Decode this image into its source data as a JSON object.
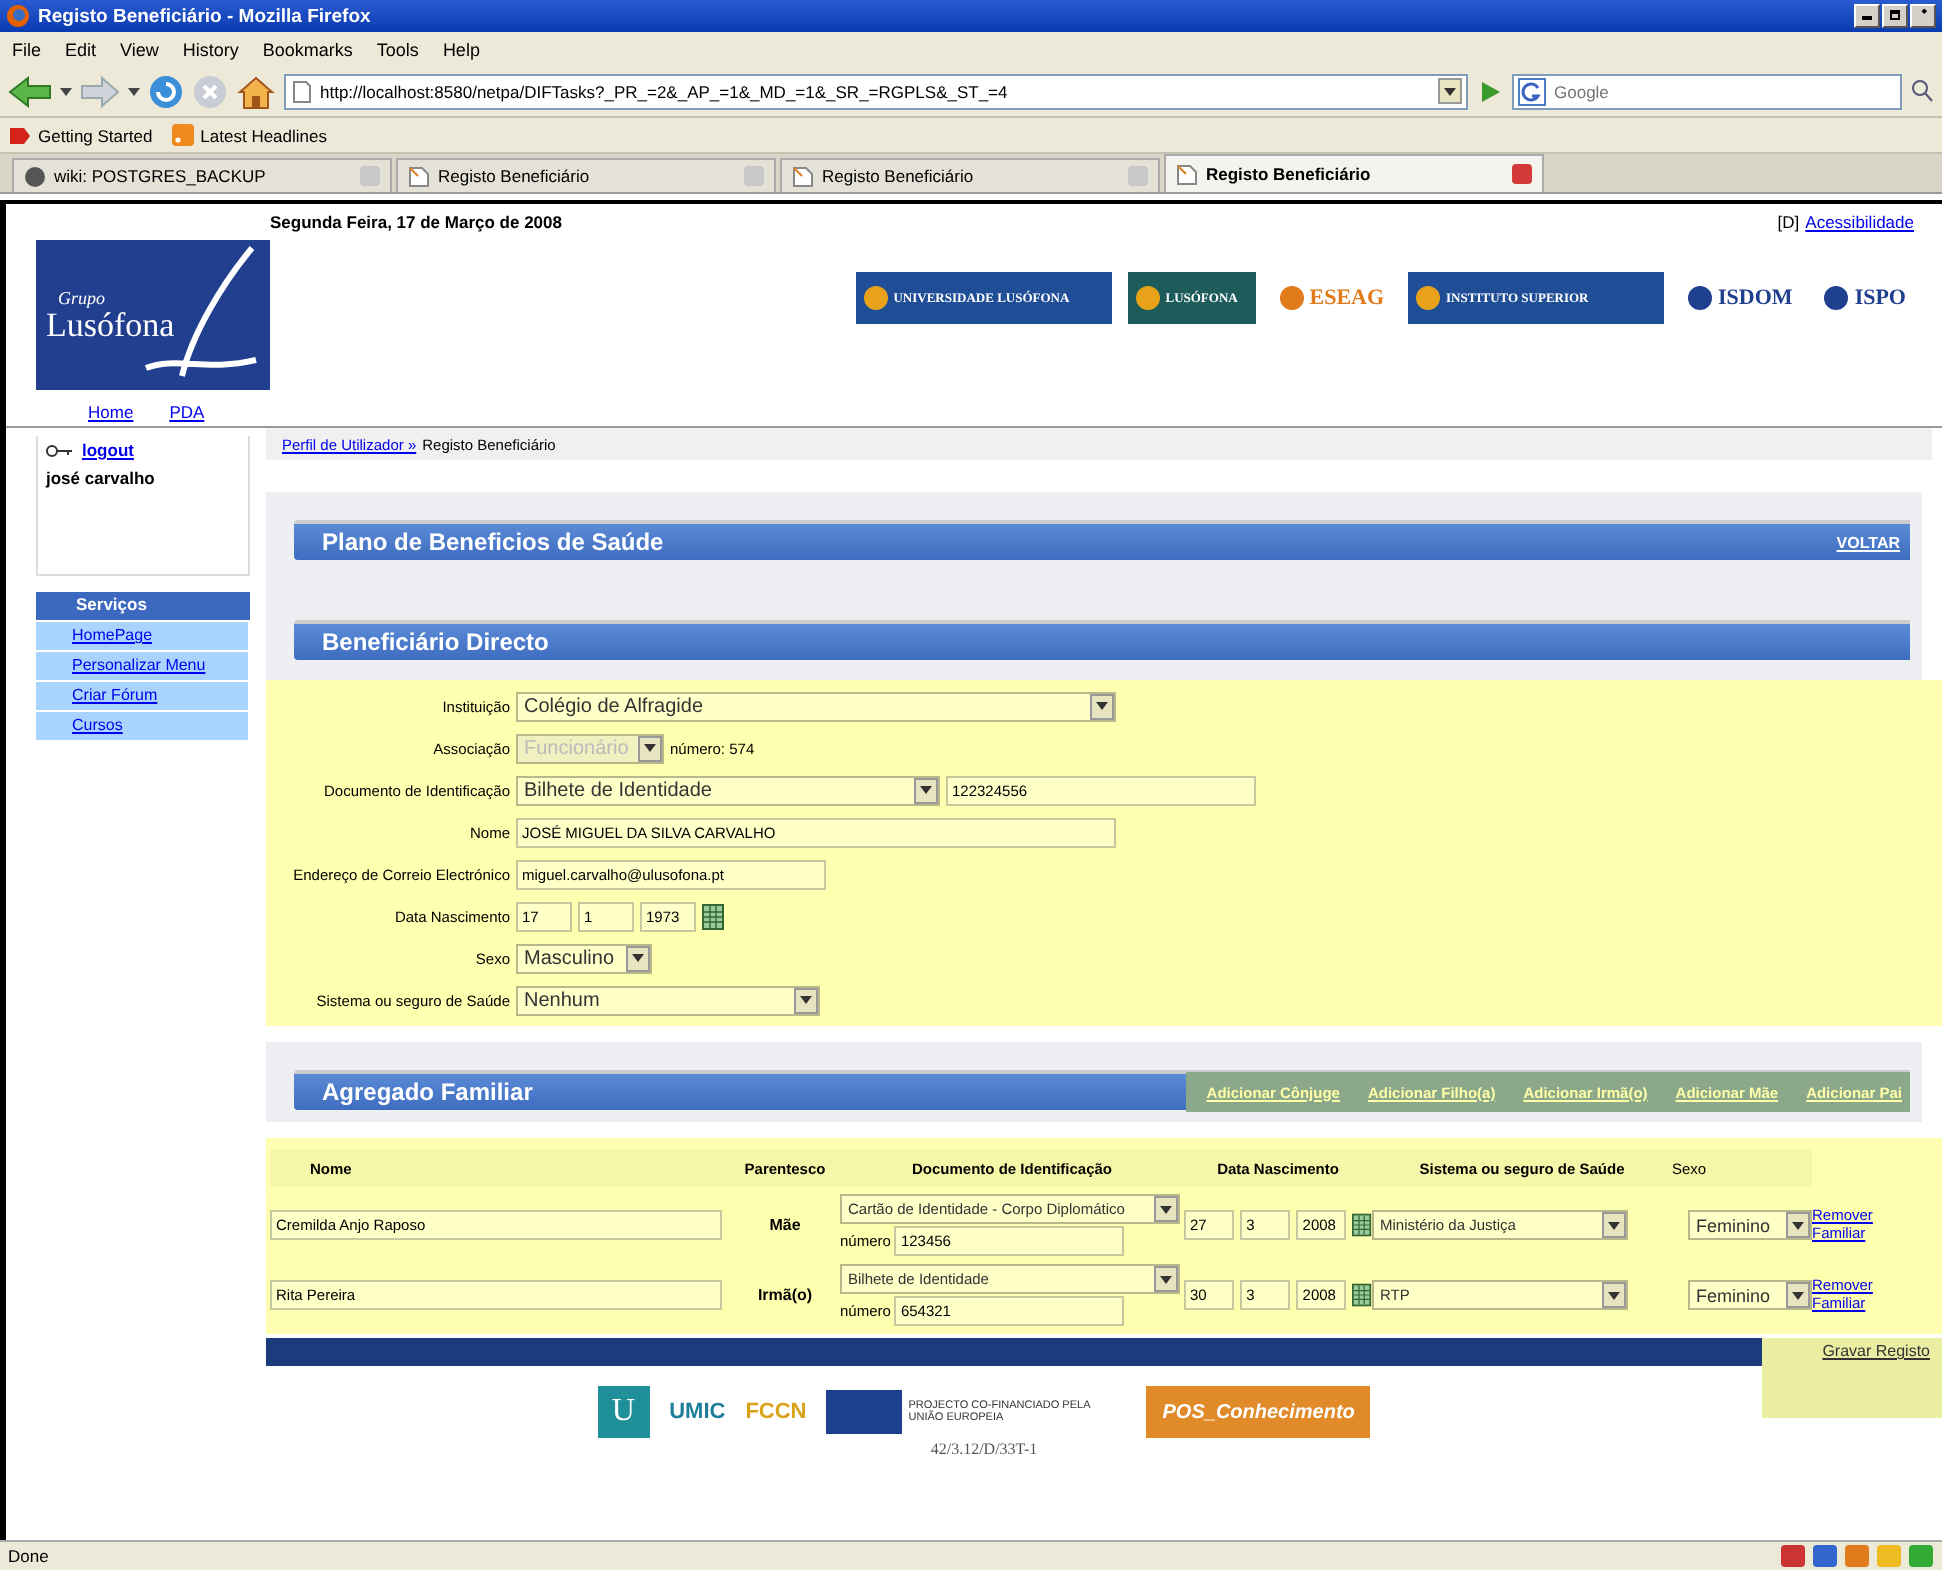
{
  "browser": {
    "title": "Registo Beneficiário - Mozilla Firefox",
    "menu": [
      "File",
      "Edit",
      "View",
      "History",
      "Bookmarks",
      "Tools",
      "Help"
    ],
    "url": "http://localhost:8580/netpa/DIFTasks?_PR_=2&_AP_=1&_MD_=1&_SR_=RGPLS&_ST_=4",
    "search_placeholder": "Google",
    "bookmarks": [
      "Getting Started",
      "Latest Headlines"
    ],
    "tabs": [
      {
        "label": "wiki: POSTGRES_BACKUP",
        "selected": false
      },
      {
        "label": "Registo Beneficiário",
        "selected": false
      },
      {
        "label": "Registo Beneficiário",
        "selected": false
      },
      {
        "label": "Registo Beneficiário",
        "selected": true
      }
    ],
    "status": "Done"
  },
  "header": {
    "date": "Segunda Feira, 17 de Março de 2008",
    "access_key": "[D]",
    "accessibility": "Acessibilidade",
    "logo_small": "Grupo",
    "logo_name": "Lusófona",
    "links": [
      "Home",
      "PDA"
    ],
    "partner_logos": [
      {
        "kind": "wide",
        "text": "UNIVERSIDADE LUSÓFONA",
        "color": "#1f4e96"
      },
      {
        "kind": "wide",
        "text": "LUSÓFONA",
        "color": "#1d5c5a"
      },
      {
        "kind": "plain",
        "text": "ESEAG",
        "color": "#e07a1a"
      },
      {
        "kind": "wide",
        "text": "INSTITUTO SUPERIOR",
        "color": "#1f4e96"
      },
      {
        "kind": "plain",
        "text": "ISDOM",
        "color": "#1f3f8f"
      },
      {
        "kind": "plain",
        "text": "ISPO",
        "color": "#1f3f8f"
      }
    ]
  },
  "user": {
    "logout": "logout",
    "name": "josé carvalho"
  },
  "services": {
    "title": "Serviços",
    "items": [
      "HomePage",
      "Personalizar Menu",
      "Criar Fórum",
      "Cursos"
    ]
  },
  "breadcrumb": {
    "parent": "Perfil de Utilizador »",
    "current": "Registo Beneficiário"
  },
  "plan": {
    "title": "Plano de Beneficios de Saúde",
    "back": "VOLTAR"
  },
  "direct": {
    "title": "Beneficiário Directo",
    "fields": [
      {
        "kind": "select",
        "label": "Instituição",
        "value": "Colégio de Alfragide",
        "disabled": false
      },
      {
        "kind": "select",
        "label": "Associação",
        "value": "Funcionário",
        "disabled": true,
        "note": "número: 574"
      },
      {
        "kind": "select",
        "label": "Documento de Identificação",
        "value": "Bilhete de Identidade",
        "disabled": false,
        "extra_value": "122324556"
      },
      {
        "kind": "input",
        "label": "Nome",
        "value": "JOSÉ MIGUEL DA SILVA CARVALHO",
        "disabled": false
      },
      {
        "kind": "input",
        "label": "Endereço de Correio Electrónico",
        "value": "miguel.carvalho@ulusofona.pt",
        "disabled": false
      },
      {
        "kind": "date",
        "label": "Data Nascimento",
        "parts": [
          "17",
          "1",
          "1973"
        ],
        "disabled": false
      },
      {
        "kind": "select",
        "label": "Sexo",
        "value": "Masculino",
        "disabled": false
      },
      {
        "kind": "select",
        "label": "Sistema ou seguro de Saúde",
        "value": "Nenhum",
        "disabled": false
      }
    ]
  },
  "family": {
    "title": "Agregado Familiar",
    "actions": [
      "Adicionar Cônjuge",
      "Adicionar Filho(a)",
      "Adicionar Irmã(o)",
      "Adicionar Mãe",
      "Adicionar Pai"
    ],
    "columns": [
      "Nome",
      "Parentesco",
      "Documento de Identificação",
      "Data Nascimento",
      "Sistema ou seguro de Saúde",
      "Sexo"
    ],
    "rows": [
      {
        "name": "Cremilda Anjo Raposo",
        "relation": "Mãe",
        "doc_type": "Cartão de Identidade - Corpo Diplomático",
        "number_label": "número",
        "number": "123456",
        "date": [
          "27",
          "3",
          "2008"
        ],
        "health": "Ministério da Justiça",
        "sex": "Feminino",
        "remove": "Remover Familiar"
      },
      {
        "name": "Rita Pereira",
        "relation": "Irmã(o)",
        "doc_type": "Bilhete de Identidade",
        "number_label": "número",
        "number": "654321",
        "date": [
          "30",
          "3",
          "2008"
        ],
        "health": "RTP",
        "sex": "Feminino",
        "remove": "Remover Familiar"
      }
    ],
    "save": "Gravar Registo"
  },
  "footer": {
    "logos": [
      {
        "kind": "square",
        "text": "U",
        "color": "#1f8f9a"
      },
      {
        "kind": "text",
        "text": "UMIC",
        "color": "#1f7f9a"
      },
      {
        "kind": "text",
        "text": "FCCN",
        "color": "#d8a21a"
      },
      {
        "kind": "flag",
        "text": "PROJECTO CO-FINANCIADO PELA UNIÃO EUROPEIA",
        "color": "#1f3f8f"
      },
      {
        "kind": "banner",
        "text": "POS_Conhecimento",
        "color": "#e08a2a"
      }
    ],
    "code": "42/3.12/D/33T-1"
  }
}
